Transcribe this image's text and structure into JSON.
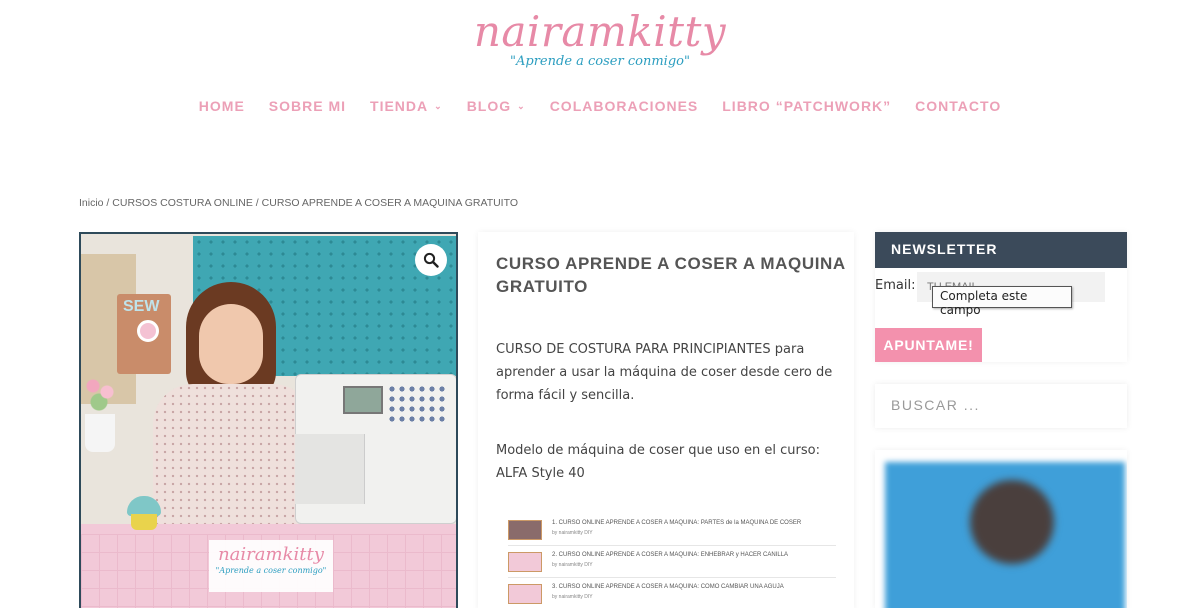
{
  "header": {
    "logo_text": "nairamkitty",
    "logo_tagline": "\"Aprende a coser conmigo\""
  },
  "nav": {
    "items": [
      {
        "label": "HOME",
        "dropdown": false
      },
      {
        "label": "SOBRE MI",
        "dropdown": false
      },
      {
        "label": "TIENDA",
        "dropdown": true
      },
      {
        "label": "BLOG",
        "dropdown": true
      },
      {
        "label": "COLABORACIONES",
        "dropdown": false
      },
      {
        "label": "LIBRO “PATCHWORK”",
        "dropdown": false
      },
      {
        "label": "CONTACTO",
        "dropdown": false
      }
    ]
  },
  "breadcrumb": {
    "home": "Inicio",
    "sep": " / ",
    "category": "CURSOS COSTURA ONLINE",
    "current": "CURSO APRENDE A COSER A MAQUINA GRATUITO"
  },
  "product": {
    "title": "CURSO APRENDE A COSER A MAQUINA GRATUITO",
    "description_p1": "CURSO DE COSTURA PARA PRINCIPIANTES para aprender a usar la máquina de coser desde cero de forma fácil y sencilla.",
    "description_p2": "Modelo de máquina de coser que uso en el curso: ALFA Style 40",
    "image_sign_text": "SEW",
    "image_watermark_main": "nairamkitty",
    "image_watermark_sub": "\"Aprende a coser conmigo\"",
    "playlist": [
      {
        "title": "1. CURSO ONLINE APRENDE A COSER A MAQUINA: PARTES de la MAQUINA DE COSER",
        "author": "by nairamkitty DIY"
      },
      {
        "title": "2. CURSO ONLINE APRENDE A COSER A MAQUINA: ENHEBRAR y HACER CANILLA",
        "author": "by nairamkitty DIY"
      },
      {
        "title": "3. CURSO ONLINE APRENDE A COSER A MAQUINA: COMO CAMBIAR UNA AGUJA",
        "author": "by nairamkitty DIY"
      }
    ]
  },
  "sidebar": {
    "newsletter": {
      "heading": "NEWSLETTER",
      "email_label": "Email:",
      "email_placeholder": "TU EMAIL",
      "validation_tooltip": "Completa este campo",
      "button_label": "APUNTAME!"
    },
    "search": {
      "placeholder": "BUSCAR ..."
    }
  },
  "colors": {
    "brand_pink": "#e78aa7",
    "nav_pink": "#eca0b7",
    "button_pink": "#f391ad",
    "newsletter_header": "#3b4a5a",
    "tagline_blue": "#2c9ec0"
  },
  "icons": {
    "zoom": "magnifier-icon",
    "dropdown": "chevron-down-icon"
  }
}
